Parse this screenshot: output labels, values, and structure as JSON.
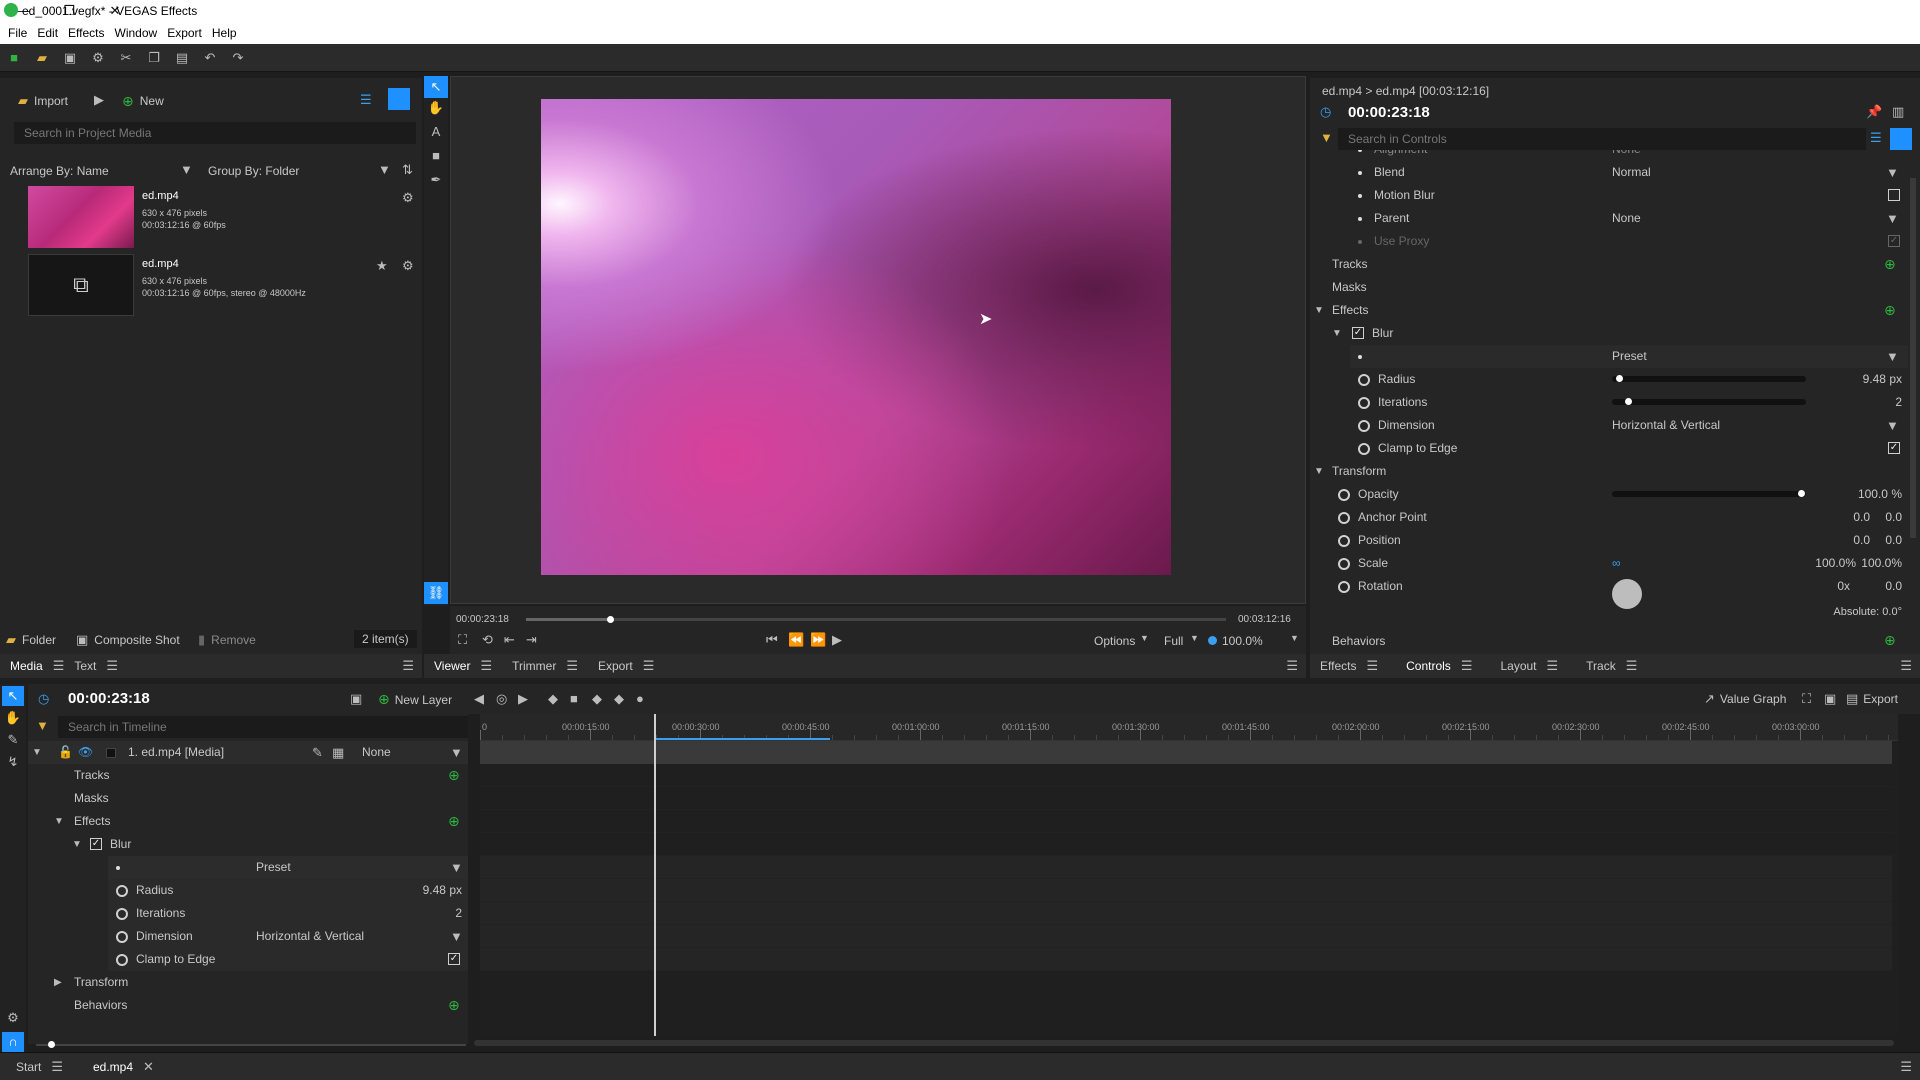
{
  "window": {
    "title": "ed_0001.vegfx* - VEGAS Effects",
    "min": "—",
    "max": "❐",
    "close": "✕"
  },
  "menu": [
    "File",
    "Edit",
    "Effects",
    "Window",
    "Export",
    "Help"
  ],
  "project": {
    "import_label": "Import",
    "new_label": "New",
    "search_placeholder": "Search in Project Media",
    "arrange_label": "Arrange By: Name",
    "group_label": "Group By: Folder",
    "items": [
      {
        "name": "ed.mp4",
        "line1": "630 x 476 pixels",
        "line2": "00:03:12:16 @ 60fps"
      },
      {
        "name": "ed.mp4",
        "line1": "630 x 476 pixels",
        "line2": "00:03:12:16 @ 60fps, stereo @ 48000Hz"
      }
    ],
    "folder_label": "Folder",
    "composite_label": "Composite Shot",
    "remove_label": "Remove",
    "count_label": "2 item(s)",
    "tabs": [
      "Media",
      "Text"
    ]
  },
  "viewer": {
    "current_time": "00:00:23:18",
    "end_time": "00:03:12:16",
    "progress": 0.12,
    "options_label": "Options",
    "quality_label": "Full",
    "zoom_label": "100.0%",
    "tabs": [
      "Viewer",
      "Trimmer",
      "Export"
    ]
  },
  "controls": {
    "breadcrumb": "ed.mp4 > ed.mp4 [00:03:12:16]",
    "time": "00:00:23:18",
    "search_placeholder": "Search in Controls",
    "alignment_label": "Alignment",
    "alignment_value": "None",
    "blend_label": "Blend",
    "blend_value": "Normal",
    "motion_blur_label": "Motion Blur",
    "parent_label": "Parent",
    "parent_value": "None",
    "use_proxy_label": "Use Proxy",
    "tracks_label": "Tracks",
    "masks_label": "Masks",
    "effects_label": "Effects",
    "blur_label": "Blur",
    "preset_label": "Preset",
    "radius_label": "Radius",
    "radius_value": "9.48 px",
    "radius_level": 0.02,
    "iterations_label": "Iterations",
    "iterations_value": "2",
    "iterations_level": 0.07,
    "dimension_label": "Dimension",
    "dimension_value": "Horizontal & Vertical",
    "clamp_label": "Clamp to Edge",
    "transform_label": "Transform",
    "opacity_label": "Opacity",
    "opacity_value": "100.0 %",
    "opacity_level": 1.0,
    "anchor_label": "Anchor Point",
    "anchor_x": "0.0",
    "anchor_y": "0.0",
    "position_label": "Position",
    "position_x": "0.0",
    "position_y": "0.0",
    "scale_label": "Scale",
    "scale_x": "100.0%",
    "scale_y": "100.0%",
    "rotation_label": "Rotation",
    "rotation_turns": "0x",
    "rotation_value": "0.0",
    "absolute_label": "Absolute: 0.0°",
    "behaviors_label": "Behaviors",
    "tabs": [
      "Effects",
      "Controls",
      "Layout",
      "Track"
    ]
  },
  "timeline": {
    "time": "00:00:23:18",
    "new_layer_label": "New Layer",
    "value_graph_label": "Value Graph",
    "export_label": "Export",
    "search_placeholder": "Search in Timeline",
    "layer_label": "1. ed.mp4 [Media]",
    "layer_blend": "None",
    "tracks_label": "Tracks",
    "masks_label": "Masks",
    "effects_label": "Effects",
    "blur_label": "Blur",
    "preset_label": "Preset",
    "radius_label": "Radius",
    "radius_value": "9.48 px",
    "iterations_label": "Iterations",
    "iterations_value": "2",
    "dimension_label": "Dimension",
    "dimension_value": "Horizontal & Vertical",
    "clamp_label": "Clamp to Edge",
    "transform_label": "Transform",
    "behaviors_label": "Behaviors",
    "ruler": [
      "0",
      "00:00:15:00",
      "00:00:30:00",
      "00:00:45:00",
      "00:01:00:00",
      "00:01:15:00",
      "00:01:30:00",
      "00:01:45:00",
      "00:02:00:00",
      "00:02:15:00",
      "00:02:30:00",
      "00:02:45:00",
      "00:03:00:00"
    ],
    "playhead_fraction": 0.1225
  },
  "bottom_tabs": [
    "Start",
    "ed.mp4"
  ],
  "colors": {
    "accent": "#1e90ff",
    "green": "#2fb43f",
    "panel": "#252525"
  }
}
